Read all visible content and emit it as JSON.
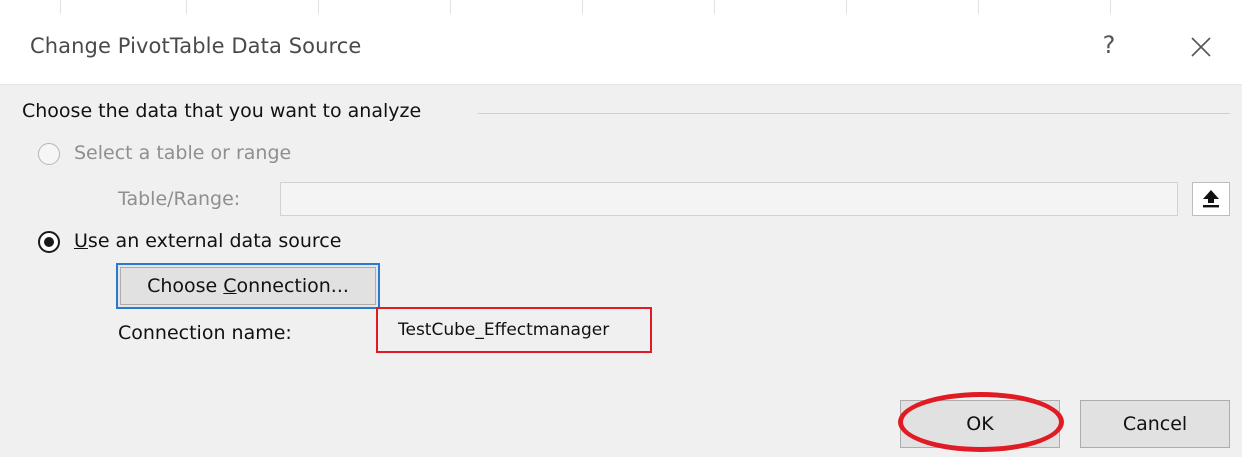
{
  "dialog": {
    "title": "Change PivotTable Data Source",
    "help_glyph": "?",
    "close_icon": "close-icon"
  },
  "group": {
    "label": "Choose the data that you want to analyze"
  },
  "option_table": {
    "label": "Select a table or range",
    "selected": false,
    "enabled": false,
    "range_label": "Table/Range:",
    "range_value": "",
    "collapse_icon": "range-collapse-icon"
  },
  "option_external": {
    "label_first_char": "U",
    "label_rest": "se an external data source",
    "selected": true,
    "choose_button_prefix": "Choose ",
    "choose_button_underlined": "C",
    "choose_button_suffix": "onnection...",
    "connection_label": "Connection name:",
    "connection_value": "TestCube_Effectmanager"
  },
  "buttons": {
    "ok": "OK",
    "cancel": "Cancel"
  },
  "colors": {
    "highlight": "#e01b24",
    "focus": "#2b78d0"
  }
}
